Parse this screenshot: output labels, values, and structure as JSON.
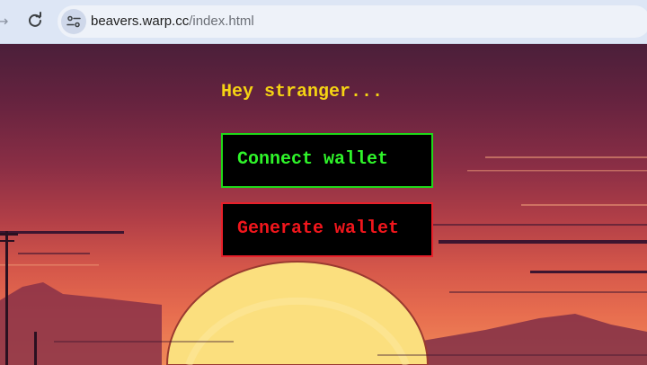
{
  "browser": {
    "url_host": "beavers.warp.cc",
    "url_path": "/index.html",
    "icons": {
      "back": "back-arrow-icon",
      "reload": "reload-icon",
      "site_info": "tune-icon"
    }
  },
  "page": {
    "greeting": "Hey stranger...",
    "connect_label": "Connect wallet",
    "generate_label": "Generate wallet",
    "colors": {
      "greeting": "#f5d313",
      "connect": "#2ff52a",
      "generate": "#f0161c",
      "button_bg": "#000000"
    }
  }
}
